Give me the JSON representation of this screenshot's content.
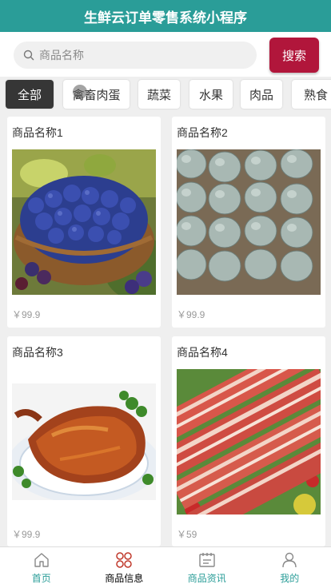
{
  "app": {
    "title": "生鲜云订单零售系统小程序"
  },
  "search": {
    "placeholder": "商品名称",
    "button_label": "搜索"
  },
  "categories": [
    "全部",
    "禽畜肉蛋",
    "蔬菜",
    "水果",
    "肉品",
    "熟食"
  ],
  "products": [
    {
      "name": "商品名称1",
      "price": "￥99.9",
      "image": "blueberries-basket"
    },
    {
      "name": "商品名称2",
      "price": "￥99.9",
      "image": "eggs-tray"
    },
    {
      "name": "商品名称3",
      "price": "￥99.9",
      "image": "roast-duck"
    },
    {
      "name": "商品名称4",
      "price": "￥59",
      "image": "pork-belly"
    }
  ],
  "tabbar": [
    {
      "label": "首页",
      "icon": "home-icon"
    },
    {
      "label": "商品信息",
      "icon": "grid-icon",
      "active": true
    },
    {
      "label": "商品资讯",
      "icon": "news-icon"
    },
    {
      "label": "我的",
      "icon": "user-icon"
    }
  ],
  "colors": {
    "primary": "#2a9d98",
    "search_button": "#b1163b",
    "active_tab_chip": "#363636"
  }
}
